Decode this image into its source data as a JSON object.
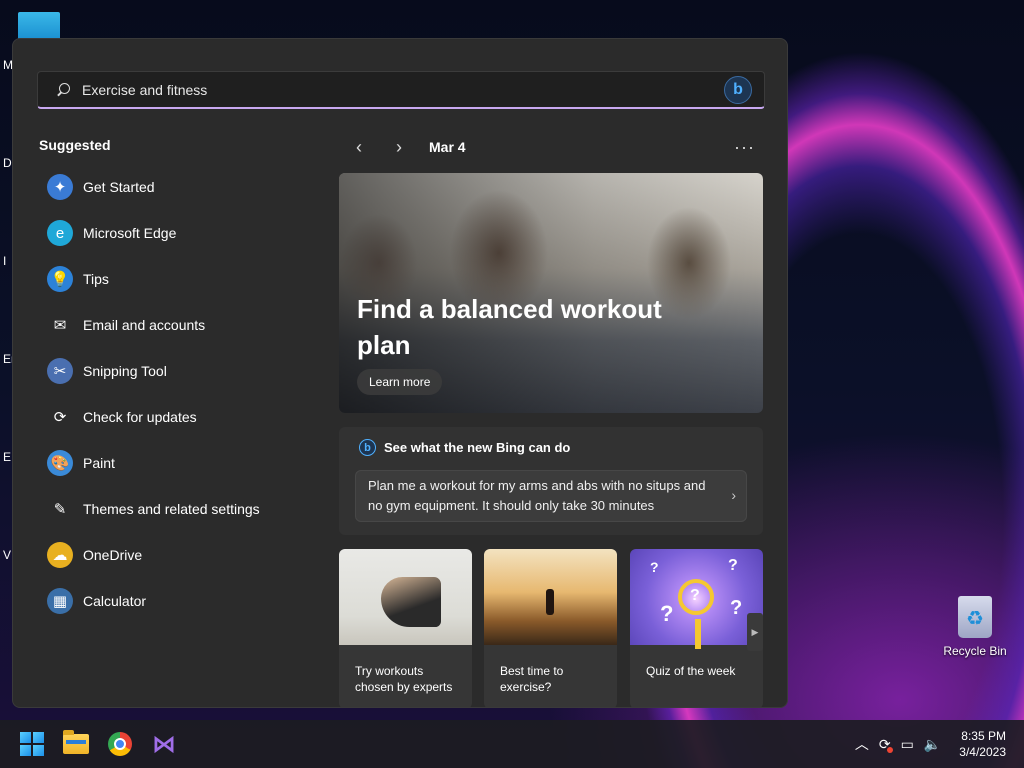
{
  "desktop": {
    "edge_letters": [
      "M",
      "Da",
      "I",
      "Er",
      "E",
      "V"
    ],
    "recycle_bin_label": "Recycle Bin"
  },
  "search": {
    "value": "Exercise and fitness",
    "bing_label": "b"
  },
  "suggested": {
    "title": "Suggested",
    "items": [
      {
        "label": "Get Started",
        "icon": "get-started-icon",
        "glyph": "✦",
        "color": "#3a7bd5"
      },
      {
        "label": "Microsoft Edge",
        "icon": "edge-icon",
        "glyph": "e",
        "color": "#1fa8d8"
      },
      {
        "label": "Tips",
        "icon": "lightbulb-icon",
        "glyph": "💡",
        "color": "#2c82d8"
      },
      {
        "label": "Email and accounts",
        "icon": "mail-icon",
        "glyph": "✉",
        "color": "transparent"
      },
      {
        "label": "Snipping Tool",
        "icon": "scissors-icon",
        "glyph": "✂",
        "color": "#4a6fb0"
      },
      {
        "label": "Check for updates",
        "icon": "refresh-icon",
        "glyph": "⟳",
        "color": "transparent"
      },
      {
        "label": "Paint",
        "icon": "palette-icon",
        "glyph": "🎨",
        "color": "#3a8ad8"
      },
      {
        "label": "Themes and related settings",
        "icon": "brush-icon",
        "glyph": "✎",
        "color": "transparent"
      },
      {
        "label": "OneDrive",
        "icon": "cloud-icon",
        "glyph": "☁",
        "color": "#e8b020"
      },
      {
        "label": "Calculator",
        "icon": "calculator-icon",
        "glyph": "▦",
        "color": "#3a6fa8"
      }
    ]
  },
  "feed": {
    "prev": "‹",
    "next": "›",
    "date": "Mar 4",
    "more": "···",
    "hero_title": "Find a balanced workout plan",
    "hero_button": "Learn more",
    "bing_header": "See what the new Bing can do",
    "bing_prompt": "Plan me a workout for my arms and abs with no situps and no gym equipment. It should only take 30 minutes",
    "prompt_chevron": "›",
    "tiles": [
      {
        "caption": "Try workouts chosen by experts"
      },
      {
        "caption": "Best time to exercise?"
      },
      {
        "caption": "Quiz of the week"
      }
    ],
    "scroll": "▶"
  },
  "taskbar": {
    "apps": [
      "windows-start",
      "file-explorer",
      "chrome",
      "visual-studio"
    ],
    "tray": {
      "chevron": "︿",
      "time": "8:35 PM",
      "date": "3/4/2023"
    }
  }
}
